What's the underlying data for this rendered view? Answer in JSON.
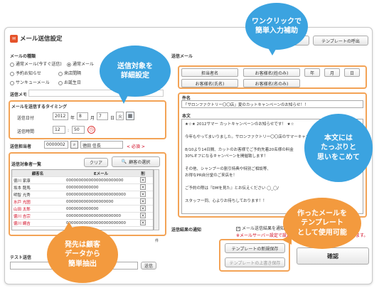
{
  "window": {
    "title": "メール送信設定"
  },
  "top_buttons": {
    "left_label": "",
    "template_call": "テンプレートの呼出"
  },
  "mail_type": {
    "heading": "メールの種類",
    "options": [
      "通常メール(今すぐ送信)",
      "通常メール",
      "予約お知らせ",
      "来店間隔",
      "サンキューメール",
      "お誕生日"
    ]
  },
  "send_memo": {
    "label": "送信メモ"
  },
  "timing": {
    "heading": "メールを送信するタイミング",
    "date_label": "送信日付",
    "year": "2012",
    "year_unit": "年",
    "month": "8",
    "month_unit": "月",
    "day": "7",
    "day_unit": "日",
    "weekday": "火",
    "time_label": "送信時間",
    "hour": "12",
    "hour_sep": ":",
    "minute": "50"
  },
  "sender": {
    "label": "送信担当者",
    "code": "0000002",
    "name": "徳田 信長",
    "required": "< 必須 >"
  },
  "recipients": {
    "heading": "送信対象者一覧",
    "clear_button": "クリア",
    "select_button": "顧客の選択",
    "columns": [
      "顧客名",
      "Eメール",
      "削"
    ],
    "rows": [
      {
        "name": "徳川 家康",
        "email": "00000000000000000000000",
        "red": false
      },
      {
        "name": "坂本 龍馬",
        "email": "0000000000000",
        "red": false
      },
      {
        "name": "明智 光秀",
        "email": "000000000000000000000000",
        "red": false
      },
      {
        "name": "水戸 光圀",
        "email": "0000000000000000000",
        "red": true
      },
      {
        "name": "山田 太郎",
        "email": "0000000000000",
        "red": true
      },
      {
        "name": "徳川 吉宗",
        "email": "0000000000000000000000",
        "red": true
      },
      {
        "name": "徳川 綱吉",
        "email": "000000000000000000000000",
        "red": true
      }
    ],
    "count_label": "件"
  },
  "test_send": {
    "label": "テスト送信",
    "button": "送信"
  },
  "mail_body": {
    "heading": "送信メール",
    "tags_row1": [
      "担当者名",
      "お客様名(姓のみ)",
      "年",
      "月",
      "日"
    ],
    "tags_row2": [
      "お客様名(氏名)",
      "お客様名(名のみ)"
    ],
    "subject_label": "件名",
    "subject_value": "「サロンファクトリー〇〇店」夏のカットキャンペーンのお知らせ！！",
    "body_label": "本文",
    "body_lines": [
      "★☆★ 2012サマー カットキャンペーンのお知らせです！ ★☆",
      "",
      "今年もやってまいりました。サロンファクトリー〇〇店のサマーキャン",
      "",
      "8/10より14日間、カットのお客様でご予約先着20名様の料金",
      "30%オフになるキャンペーンを開催致します！",
      "",
      "その他、シャンプーの割引特典や特別ご相談等、",
      "お得なPR自分堂のご来店を！",
      "",
      "ご予約の際は『DMを見た』とお伝えください ◯_◯/",
      "",
      "スタッフ一同、心よりお待ちしております！！"
    ]
  },
  "result_notify": {
    "label": "送信結果の通知",
    "checkbox_label": "メール送信結果を通知",
    "note": "※メールサーバー設定で設定",
    "note_tail": "ます。"
  },
  "template_buttons": {
    "new_save": "テンプレートの新規保存",
    "overwrite": "テンプレートの上書き保存"
  },
  "confirm_button": "確認",
  "callouts": {
    "one_click": [
      "ワンクリックで",
      "簡単入力補助"
    ],
    "target_timing": [
      "送信対象を",
      "詳細設定"
    ],
    "body_plenty": [
      "本文には",
      "たっぷりと",
      "思いをこめて"
    ],
    "customer_extract": [
      "発先は顧客",
      "データから",
      "簡単抽出"
    ],
    "template_use": [
      "作ったメールを",
      "テンプレート",
      "として使用可能"
    ]
  },
  "colors": {
    "blue_bubble": "#3ba3e0",
    "orange_bubble": "#f39a3e",
    "orange_frame": "#f3a356",
    "red_text": "#d0021b"
  }
}
